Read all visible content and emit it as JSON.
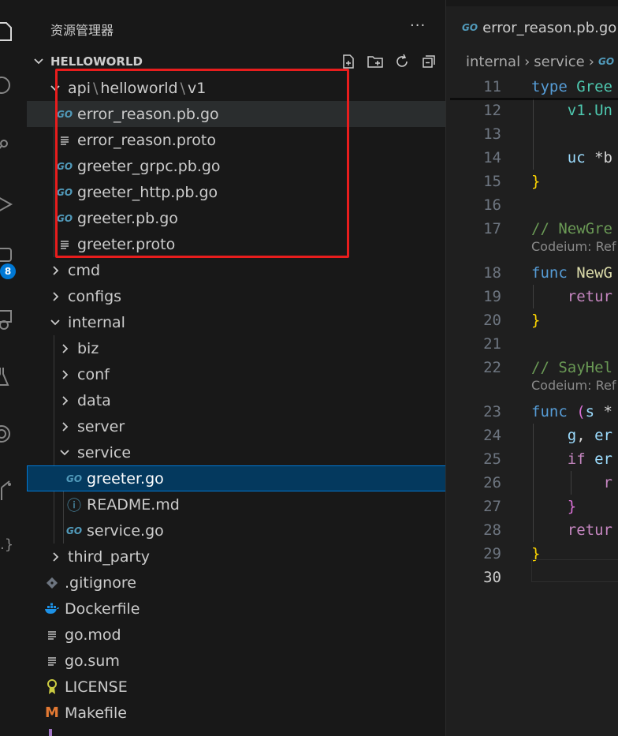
{
  "explorer": {
    "title": "资源管理器",
    "more": "···",
    "project": "HELLOWORLD"
  },
  "activity": {
    "badge": "8"
  },
  "tree": {
    "api_path": {
      "a": "api",
      "b": "helloworld",
      "c": "v1"
    },
    "api_files": [
      {
        "label": "error_reason.pb.go",
        "icon": "go"
      },
      {
        "label": "error_reason.proto",
        "icon": "lines"
      },
      {
        "label": "greeter_grpc.pb.go",
        "icon": "go"
      },
      {
        "label": "greeter_http.pb.go",
        "icon": "go"
      },
      {
        "label": "greeter.pb.go",
        "icon": "go"
      },
      {
        "label": "greeter.proto",
        "icon": "lines"
      }
    ],
    "cmd": "cmd",
    "configs": "configs",
    "internal": "internal",
    "internal_children": [
      "biz",
      "conf",
      "data",
      "server"
    ],
    "service": "service",
    "service_files": [
      {
        "label": "greeter.go",
        "icon": "go"
      },
      {
        "label": "README.md",
        "icon": "info"
      },
      {
        "label": "service.go",
        "icon": "go"
      }
    ],
    "third_party": "third_party",
    "root_files": [
      {
        "label": ".gitignore",
        "icon": "git"
      },
      {
        "label": "Dockerfile",
        "icon": "docker"
      },
      {
        "label": "go.mod",
        "icon": "lines"
      },
      {
        "label": "go.sum",
        "icon": "lines"
      },
      {
        "label": "LICENSE",
        "icon": "license"
      },
      {
        "label": "Makefile",
        "icon": "makefile"
      }
    ]
  },
  "icons": {
    "go": "GO",
    "info": "ⓘ",
    "makefile": "M",
    "license_color": "#cbcb41",
    "docker_color": "#1d91e6",
    "makefile_color": "#e37933",
    "git_color": "#6d7580"
  },
  "editor": {
    "tab": "error_reason.pb.go",
    "breadcrumb": [
      "internal",
      "service"
    ],
    "lens": "Codeium: Ref",
    "lines": [
      {
        "n": "11",
        "parts": [
          [
            "kw",
            "type "
          ],
          [
            "ty",
            "Gree"
          ]
        ]
      },
      {
        "n": "12",
        "parts": [
          [
            "ty",
            "    v1.Un"
          ]
        ]
      },
      {
        "n": "13",
        "parts": []
      },
      {
        "n": "14",
        "parts": [
          [
            "ct-var",
            "    uc "
          ],
          [
            "plain",
            "*b"
          ]
        ]
      },
      {
        "n": "15",
        "parts": [
          [
            "br1",
            "}"
          ]
        ]
      },
      {
        "n": "16",
        "parts": []
      },
      {
        "n": "17",
        "parts": [
          [
            "cm",
            "// NewGre"
          ]
        ]
      },
      {
        "n": "18",
        "parts": [
          [
            "kw",
            "func "
          ],
          [
            "fn",
            "NewG"
          ]
        ]
      },
      {
        "n": "19",
        "parts": [
          [
            "ctl",
            "    retur"
          ]
        ]
      },
      {
        "n": "20",
        "parts": [
          [
            "br1",
            "}"
          ]
        ]
      },
      {
        "n": "21",
        "parts": []
      },
      {
        "n": "22",
        "parts": [
          [
            "cm",
            "// SayHel"
          ]
        ]
      },
      {
        "n": "23",
        "parts": [
          [
            "kw",
            "func "
          ],
          [
            "br2",
            "("
          ],
          [
            "ct-var",
            "s "
          ],
          [
            "plain",
            "*"
          ]
        ]
      },
      {
        "n": "24",
        "parts": [
          [
            "ct-var",
            "    g"
          ],
          [
            "plain",
            ", "
          ],
          [
            "ct-var",
            "er"
          ]
        ]
      },
      {
        "n": "25",
        "parts": [
          [
            "ctl",
            "    if "
          ],
          [
            "ct-var",
            "er"
          ]
        ]
      },
      {
        "n": "26",
        "parts": [
          [
            "ctl",
            "        r"
          ]
        ]
      },
      {
        "n": "27",
        "parts": [
          [
            "br2",
            "    }"
          ]
        ]
      },
      {
        "n": "28",
        "parts": [
          [
            "ctl",
            "    retur"
          ]
        ]
      },
      {
        "n": "29",
        "parts": [
          [
            "br1",
            "}"
          ]
        ]
      },
      {
        "n": "30",
        "parts": []
      }
    ]
  }
}
